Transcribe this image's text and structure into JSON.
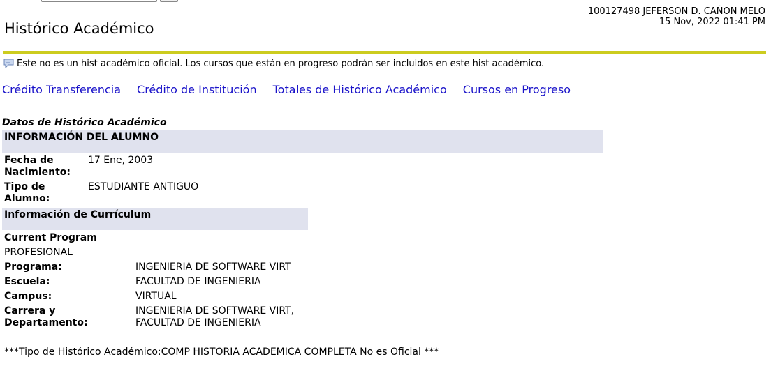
{
  "header": {
    "user_line": "100127498 JEFERSON D. CAÑON MELO",
    "datetime": "15 Nov, 2022 01:41 PM",
    "title": "Histórico Académico"
  },
  "notice": {
    "icon": "info-bubble-icon",
    "text": "Este no es un hist académico oficial. Los cursos que están en progreso podrán ser incluidos en este hist académico."
  },
  "nav": {
    "links": [
      "Crédito Transferencia",
      "Crédito de Institución",
      "Totales de Histórico Académico",
      "Cursos en Progreso"
    ]
  },
  "section": {
    "caption": "Datos de Histórico Académico",
    "student_header": "INFORMACIÓN DEL ALUMNO",
    "birth_label_1": "Fecha de",
    "birth_label_2": "Nacimiento:",
    "birth_value": "17 Ene, 2003",
    "type_label_1": "Tipo de",
    "type_label_2": "Alumno:",
    "type_value": "ESTUDIANTE ANTIGUO",
    "curriculum_header": "Información de Currículum",
    "current_program": "Current Program",
    "level": "PROFESIONAL",
    "program_label": "Programa:",
    "program_value": "INGENIERIA DE SOFTWARE VIRT",
    "school_label": "Escuela:",
    "school_value": "FACULTAD DE INGENIERIA",
    "campus_label": "Campus:",
    "campus_value": "VIRTUAL",
    "career_label_1": "Carrera y",
    "career_label_2": "Departamento:",
    "career_value_1": "INGENIERIA DE SOFTWARE VIRT,",
    "career_value_2": "FACULTAD DE INGENIERIA"
  },
  "footer_note": "***Tipo de Histórico Académico:COMP HISTORIA ACADEMICA COMPLETA No es Oficial ***",
  "colors": {
    "rule": "#cccc1f",
    "header_bar": "#e0e2ee",
    "link": "#1a13c9"
  }
}
